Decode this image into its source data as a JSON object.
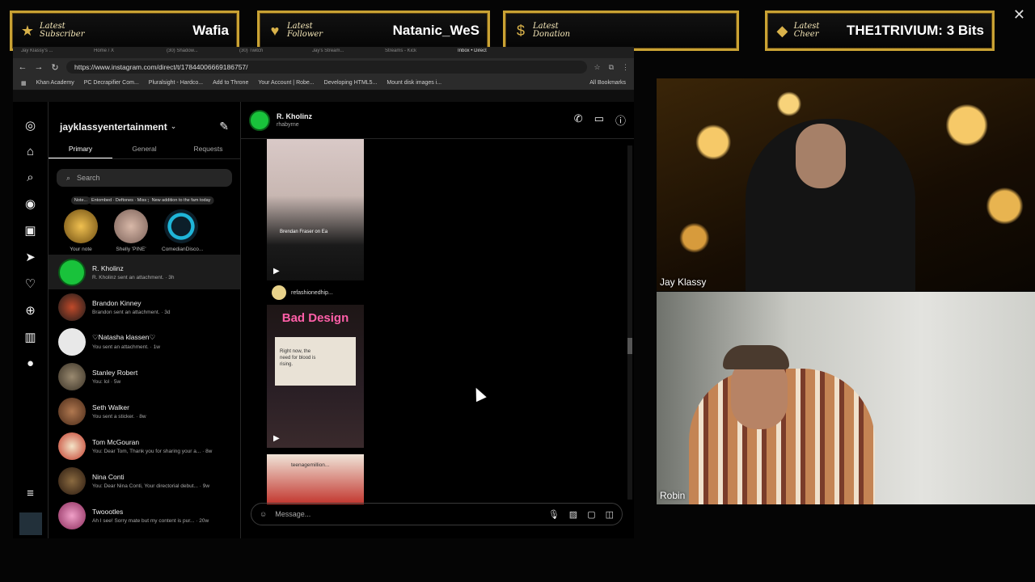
{
  "alerts": {
    "subscriber": {
      "label": "Latest Subscriber",
      "value": "Wafia"
    },
    "follower": {
      "label": "Latest Follower",
      "value": "Natanic_WeS"
    },
    "donation": {
      "label": "Latest Donation",
      "value": ""
    },
    "cheer": {
      "label": "Latest Cheer",
      "value": "THE1TRIVIUM: 3 Bits"
    }
  },
  "browser": {
    "tabs": [
      "Jay Klassy's ...",
      "Home / X",
      "(30) Shadow...",
      "(30) Twitch",
      "Jay's Stream...",
      "Streams - Kick",
      "Inbox • Direct"
    ],
    "url": "https://www.instagram.com/direct/t/17844006669186757/",
    "bookmarks": [
      "Khan Academy",
      "PC Decrapifier Com...",
      "Pluralsight - Hardco...",
      "Add to Throne",
      "Your Account | Robe...",
      "Developing HTML5...",
      "Mount disk images i..."
    ],
    "all_bookmarks": "All Bookmarks"
  },
  "inbox": {
    "account": "jayklassyentertainment",
    "tabs": [
      "Primary",
      "General",
      "Requests"
    ],
    "search_placeholder": "Search",
    "notes": [
      {
        "bubble": "Note...",
        "name": "Your note"
      },
      {
        "bubble": "Entombed · Deftones · Miss you Jame...",
        "name": "Shelly 'PINE'"
      },
      {
        "bubble": "New addition to the fam today",
        "name": "ComedianDisco..."
      }
    ],
    "threads": [
      {
        "name": "R. Kholinz",
        "preview": "R. Kholinz sent an attachment. · 3h"
      },
      {
        "name": "Brandon Kinney",
        "preview": "Brandon sent an attachment. · 3d"
      },
      {
        "name": "♡Natasha klassen♡",
        "preview": "You sent an attachment. · 1w"
      },
      {
        "name": "Stanley Robert",
        "preview": "You: lol · 5w"
      },
      {
        "name": "Seth Walker",
        "preview": "You sent a sticker. · 8w"
      },
      {
        "name": "Tom McGouran",
        "preview": "You: Dear Tom, Thank you for sharing your a... · 8w"
      },
      {
        "name": "Nina Conti",
        "preview": "You: Dear Nina Conti, Your directorial debut... · 9w"
      },
      {
        "name": "Twoootles",
        "preview": "Ah I see! Sorry mate but my content is pur... · 20w"
      }
    ]
  },
  "chat": {
    "name": "R. Kholinz",
    "handle": "rhabyrne",
    "reel1_caption": "Brendan Fraser on Ea",
    "post2_user": "refashionedhip...",
    "post2_title": "Bad Design",
    "post2_card": "Right now, the need for blood is rising.",
    "post3_user": "teenagemillion...",
    "message_placeholder": "Message..."
  },
  "cams": {
    "top_label": "Jay Klassy",
    "bottom_label": "Robin"
  }
}
